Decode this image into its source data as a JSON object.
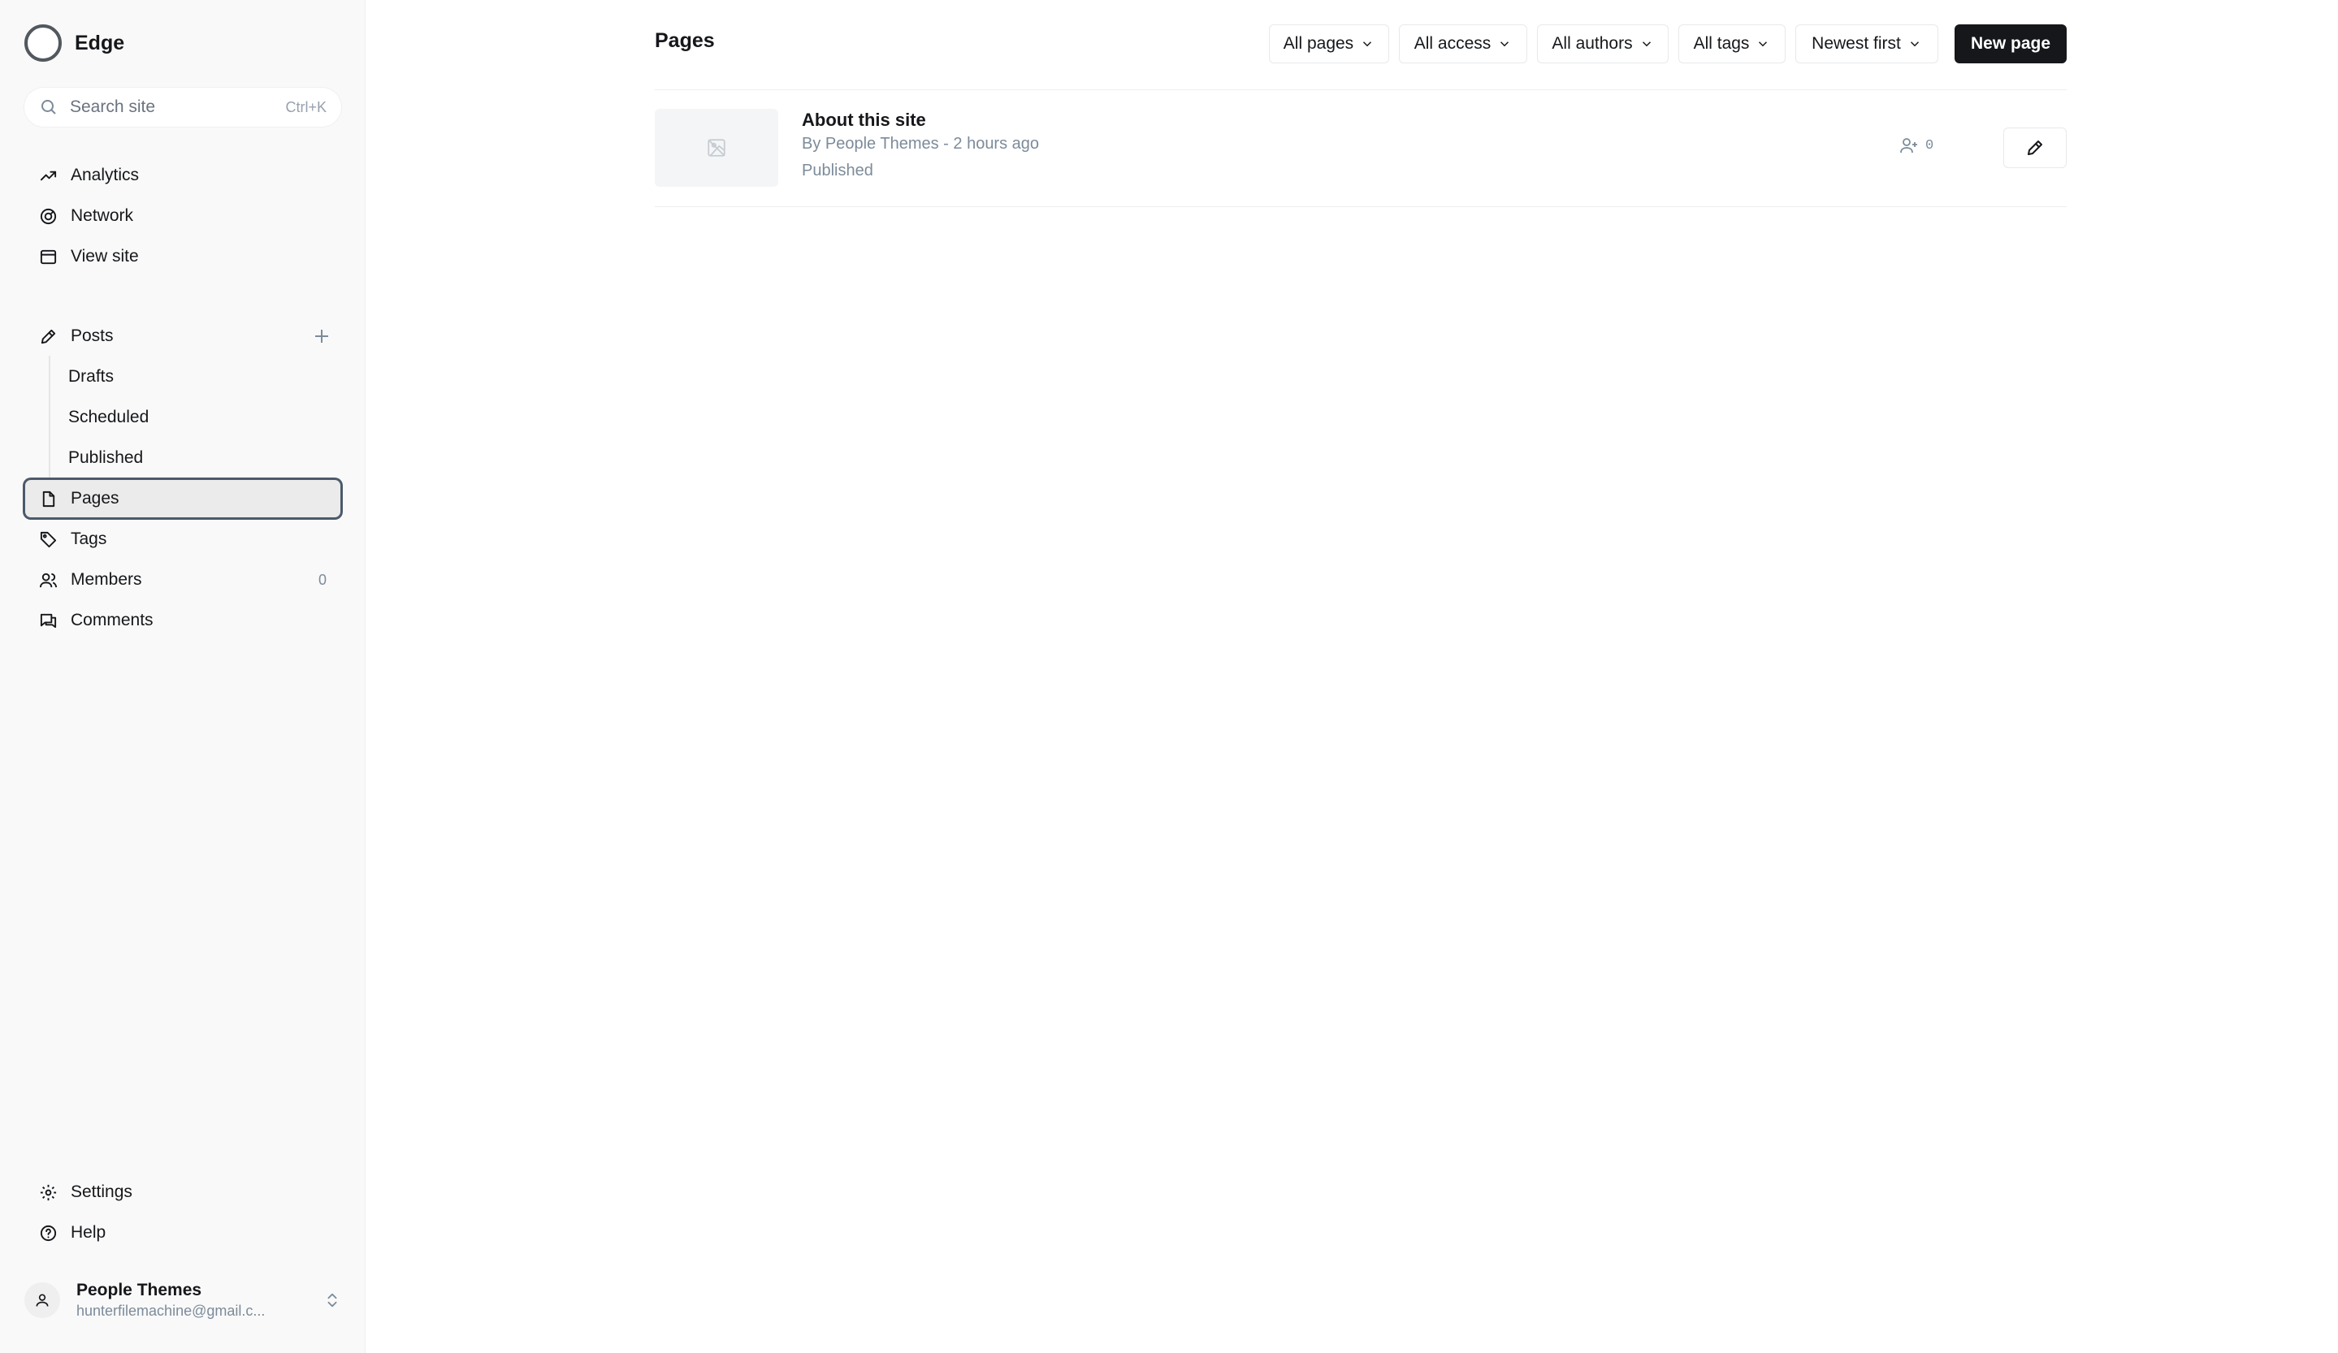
{
  "site": {
    "title": "Edge"
  },
  "search": {
    "placeholder": "Search site",
    "shortcut": "Ctrl+K"
  },
  "nav": {
    "analytics": "Analytics",
    "network": "Network",
    "view_site": "View site",
    "posts": "Posts",
    "drafts": "Drafts",
    "scheduled": "Scheduled",
    "published": "Published",
    "pages": "Pages",
    "tags": "Tags",
    "members": "Members",
    "members_count": "0",
    "comments": "Comments",
    "settings": "Settings",
    "help": "Help"
  },
  "user": {
    "name": "People Themes",
    "email": "hunterfilemachine@gmail.c..."
  },
  "header": {
    "title": "Pages",
    "filters": {
      "type": "All pages",
      "access": "All access",
      "authors": "All authors",
      "tags": "All tags",
      "sort": "Newest first"
    },
    "new_page": "New page"
  },
  "pages_list": [
    {
      "title": "About this site",
      "meta": "By People Themes - 2 hours ago",
      "status": "Published",
      "members": "0"
    }
  ],
  "colors": {
    "accent": "#15171a",
    "active_border": "#4b5a6b",
    "muted": "#7c8b9a"
  }
}
